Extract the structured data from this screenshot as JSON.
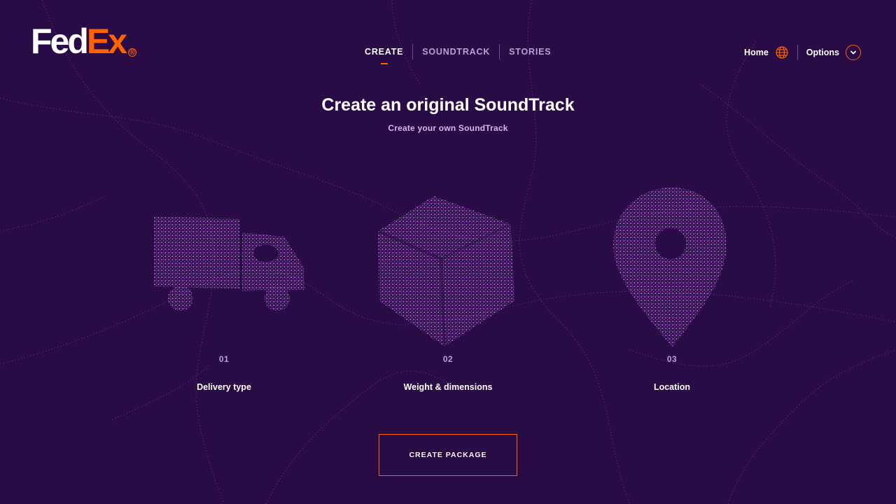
{
  "brand": {
    "logo_text_1": "Fed",
    "logo_text_2": "Ex",
    "logo_mark": "®",
    "colors": {
      "purple_bg": "#290b45",
      "orange": "#ff6200",
      "particle": "#c16ae6"
    }
  },
  "nav": {
    "items": [
      {
        "label": "CREATE",
        "active": true
      },
      {
        "label": "SOUNDTRACK",
        "active": false
      },
      {
        "label": "STORIES",
        "active": false
      }
    ]
  },
  "header_right": {
    "home_label": "Home",
    "home_icon": "globe-icon",
    "options_label": "Options",
    "options_icon": "chevron-down-icon"
  },
  "hero": {
    "title": "Create an original SoundTrack",
    "subtitle": "Create your own SoundTrack"
  },
  "steps": [
    {
      "number": "01",
      "label": "Delivery type",
      "icon": "truck-icon"
    },
    {
      "number": "02",
      "label": "Weight & dimensions",
      "icon": "box-icon"
    },
    {
      "number": "03",
      "label": "Location",
      "icon": "location-pin-icon"
    }
  ],
  "cta": {
    "label": "CREATE PACKAGE"
  }
}
